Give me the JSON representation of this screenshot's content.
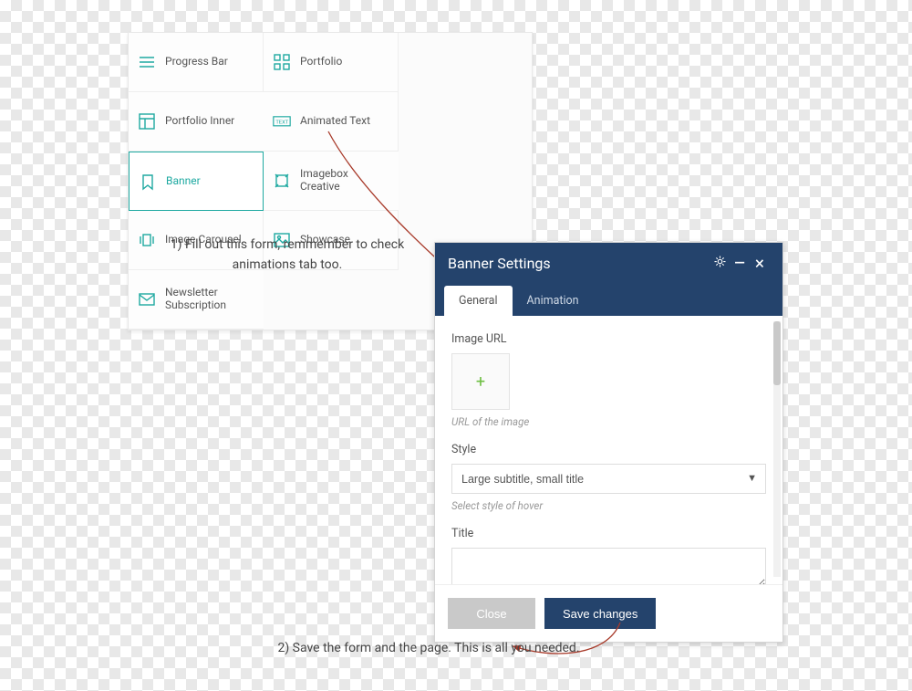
{
  "modules": [
    {
      "label": "Progress Bar",
      "icon": "hamburger"
    },
    {
      "label": "Portfolio",
      "icon": "grid"
    },
    {
      "label": "Portfolio Inner",
      "icon": "layout"
    },
    {
      "label": "Animated Text",
      "icon": "text"
    },
    {
      "label": "Banner",
      "icon": "bookmark",
      "selected": true
    },
    {
      "label": "Imagebox Creative",
      "icon": "crop"
    },
    {
      "label": "Image Carousel",
      "icon": "slides"
    },
    {
      "label": "Showcase",
      "icon": "image"
    },
    {
      "label": "Newsletter Subscription",
      "icon": "mail"
    }
  ],
  "captions": {
    "one": "1) Fill out this form, remmember to  check animations tab too.",
    "two": "2) Save the form and the page. This is all you needed."
  },
  "dialog": {
    "title": "Banner Settings",
    "tabs": {
      "general": "General",
      "animation": "Animation"
    },
    "fields": {
      "imageurl_label": "Image URL",
      "imageurl_help": "URL of the image",
      "style_label": "Style",
      "style_value": "Large subtitle, small title",
      "style_help": "Select style of hover",
      "title_label": "Title"
    },
    "buttons": {
      "close": "Close",
      "save": "Save changes"
    },
    "icons": {
      "plus": "+"
    }
  }
}
